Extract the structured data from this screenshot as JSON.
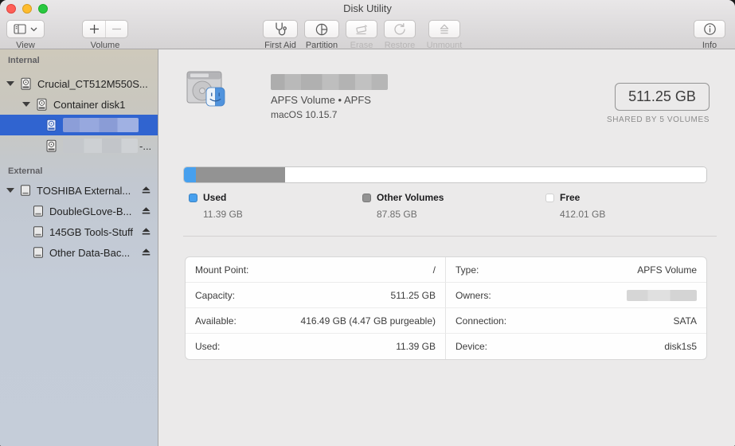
{
  "window": {
    "title": "Disk Utility"
  },
  "toolbar": {
    "view_label": "View",
    "volume_label": "Volume",
    "first_aid_label": "First Aid",
    "partition_label": "Partition",
    "erase_label": "Erase",
    "restore_label": "Restore",
    "unmount_label": "Unmount",
    "info_label": "Info"
  },
  "sidebar": {
    "internal_header": "Internal",
    "external_header": "External",
    "items": {
      "crucial": "Crucial_CT512M550S...",
      "container": "Container disk1",
      "volume2_suffix": "-...",
      "toshiba": "TOSHIBA External...",
      "doubleglove": "DoubleGLove-B...",
      "tools": "145GB Tools-Stuff",
      "otherdata": "Other Data-Bac..."
    }
  },
  "header": {
    "volume_type": "APFS Volume • APFS",
    "os_version": "macOS 10.15.7",
    "capacity_badge": "511.25 GB",
    "shared_by": "SHARED BY 5 VOLUMES"
  },
  "usage": {
    "total_gb": 511.25,
    "segments": [
      {
        "label": "Used",
        "gb": "11.39 GB",
        "value": 11.39,
        "color": "#47a0ee"
      },
      {
        "label": "Other Volumes",
        "gb": "87.85 GB",
        "value": 87.85,
        "color": "#939393"
      },
      {
        "label": "Free",
        "gb": "412.01 GB",
        "value": 412.01,
        "color": "#ffffff"
      }
    ]
  },
  "details": {
    "left": [
      {
        "label": "Mount Point:",
        "value": "/"
      },
      {
        "label": "Capacity:",
        "value": "511.25 GB"
      },
      {
        "label": "Available:",
        "value": "416.49 GB (4.47 GB purgeable)"
      },
      {
        "label": "Used:",
        "value": "11.39 GB"
      }
    ],
    "right": [
      {
        "label": "Type:",
        "value": "APFS Volume"
      },
      {
        "label": "Owners:",
        "value": ""
      },
      {
        "label": "Connection:",
        "value": "SATA"
      },
      {
        "label": "Device:",
        "value": "disk1s5"
      }
    ]
  },
  "colors": {
    "selection_blue": "#3064d0",
    "used_blue": "#47a0ee",
    "other_gray": "#939393"
  }
}
